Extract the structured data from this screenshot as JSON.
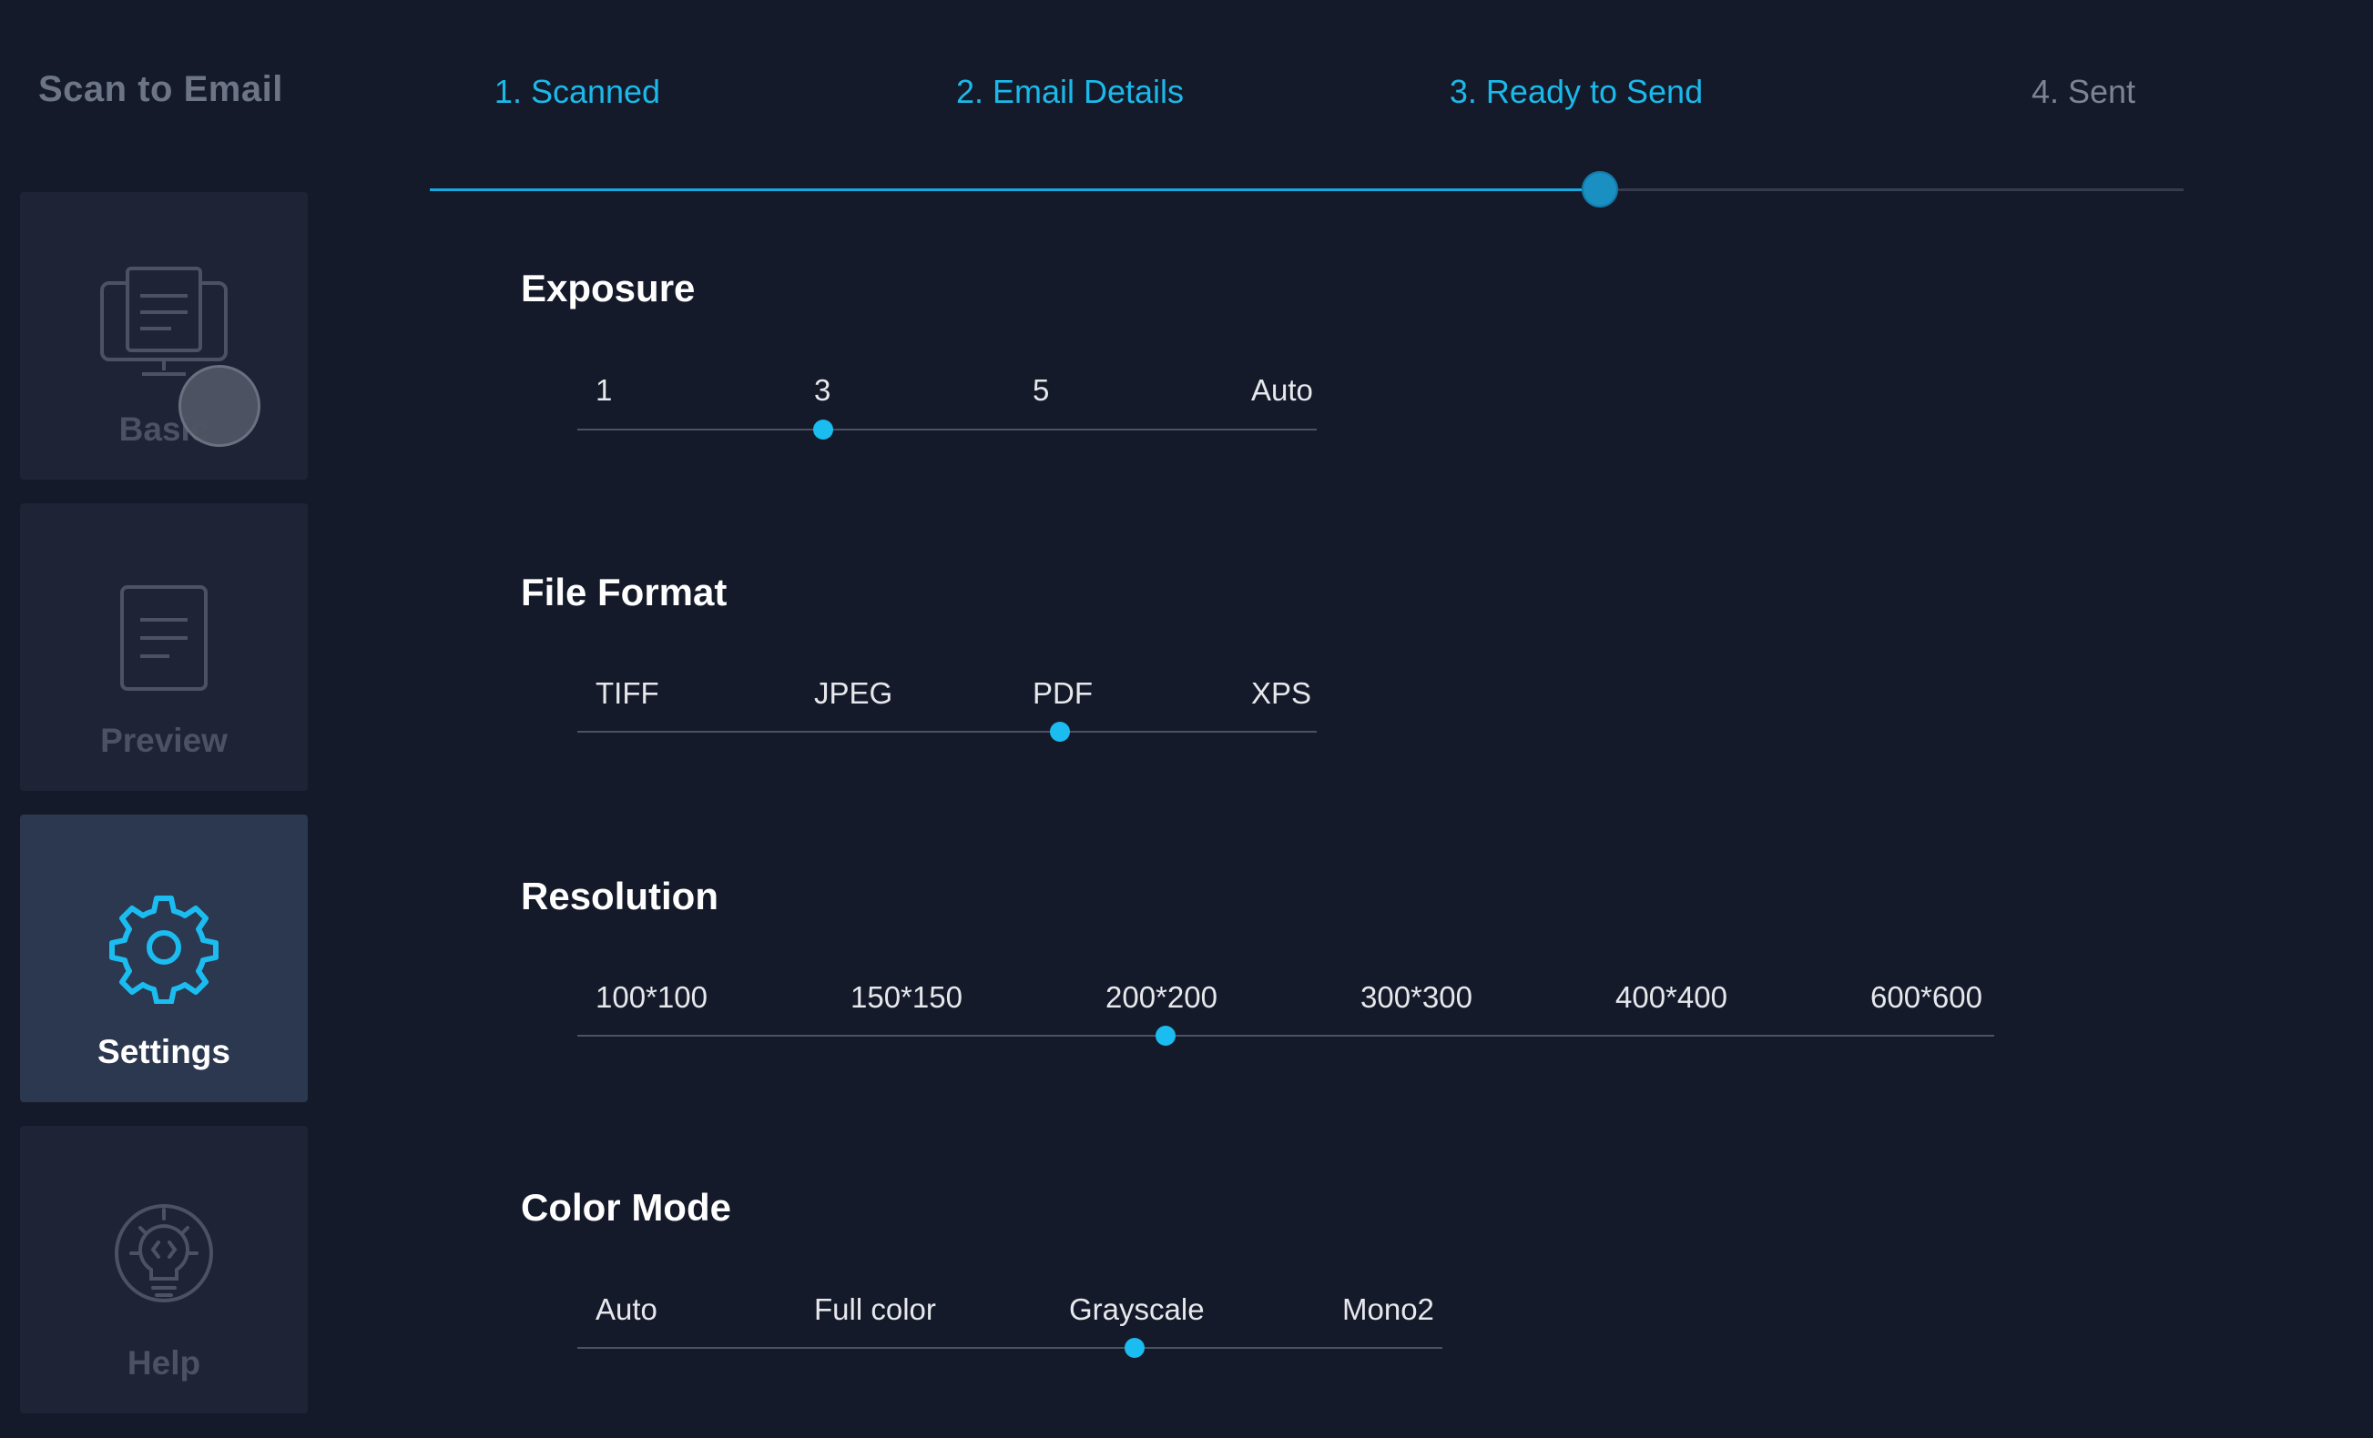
{
  "app": {
    "title": "Scan to Email"
  },
  "steps": [
    {
      "label": "1. Scanned",
      "state": "done"
    },
    {
      "label": "2. Email Details",
      "state": "done"
    },
    {
      "label": "3. Ready to Send",
      "state": "current"
    },
    {
      "label": "4. Sent",
      "state": "pending"
    }
  ],
  "progress": {
    "fraction": 0.667
  },
  "sidebar": {
    "items": [
      {
        "label": "Basic",
        "icon": "monitor-document-icon",
        "active": false
      },
      {
        "label": "Preview",
        "icon": "document-icon",
        "active": false
      },
      {
        "label": "Settings",
        "icon": "gear-icon",
        "active": true
      },
      {
        "label": "Help",
        "icon": "lightbulb-icon",
        "active": false
      }
    ]
  },
  "settings": {
    "exposure": {
      "title": "Exposure",
      "options": [
        "1",
        "3",
        "5",
        "Auto"
      ],
      "selected": "3"
    },
    "file_format": {
      "title": "File Format",
      "options": [
        "TIFF",
        "JPEG",
        "PDF",
        "XPS"
      ],
      "selected": "PDF"
    },
    "resolution": {
      "title": "Resolution",
      "options": [
        "100*100",
        "150*150",
        "200*200",
        "300*300",
        "400*400",
        "600*600"
      ],
      "selected": "200*200"
    },
    "color_mode": {
      "title": "Color Mode",
      "options": [
        "Auto",
        "Full color",
        "Grayscale",
        "Mono2"
      ],
      "selected": "Grayscale"
    }
  },
  "colors": {
    "accent": "#1bbcf0",
    "background": "#151a2a",
    "tile": "#1e2435",
    "tile_active": "#2c3750"
  }
}
